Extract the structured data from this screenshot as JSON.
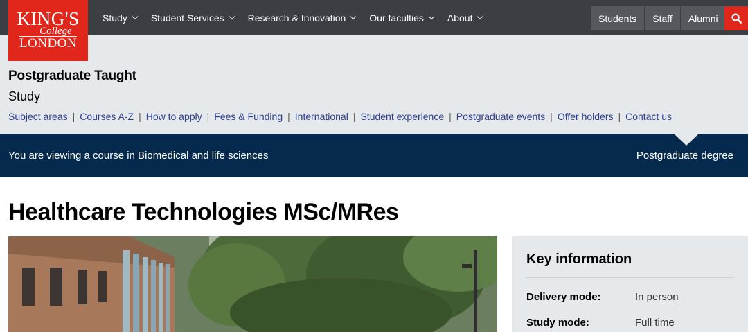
{
  "logo": {
    "line1": "KING'S",
    "line2": "College",
    "line3": "LONDON"
  },
  "nav": {
    "items": [
      {
        "label": "Study"
      },
      {
        "label": "Student Services"
      },
      {
        "label": "Research & Innovation"
      },
      {
        "label": "Our faculties"
      },
      {
        "label": "About"
      }
    ],
    "audience": [
      {
        "label": "Students"
      },
      {
        "label": "Staff"
      },
      {
        "label": "Alumni"
      }
    ],
    "search_icon": "search-icon"
  },
  "section": {
    "title": "Postgraduate Taught",
    "subtitle": "Study",
    "links": [
      "Subject areas",
      "Courses A-Z",
      "How to apply",
      "Fees & Funding",
      "International",
      "Student experience",
      "Postgraduate events",
      "Offer holders",
      "Contact us"
    ],
    "separator": "|"
  },
  "banner": {
    "text": "You are viewing a course in Biomedical and life sciences",
    "right": "Postgraduate degree"
  },
  "course": {
    "title": "Healthcare Technologies MSc/MRes"
  },
  "key_info": {
    "title": "Key information",
    "rows": [
      {
        "key": "Delivery mode:",
        "value": "In person"
      },
      {
        "key": "Study mode:",
        "value": "Full time"
      }
    ]
  },
  "colors": {
    "brand_red": "#e1261c",
    "nav_dark": "#3b3f44",
    "banner_blue": "#052a4d",
    "panel_grey": "#e5e9ec"
  }
}
